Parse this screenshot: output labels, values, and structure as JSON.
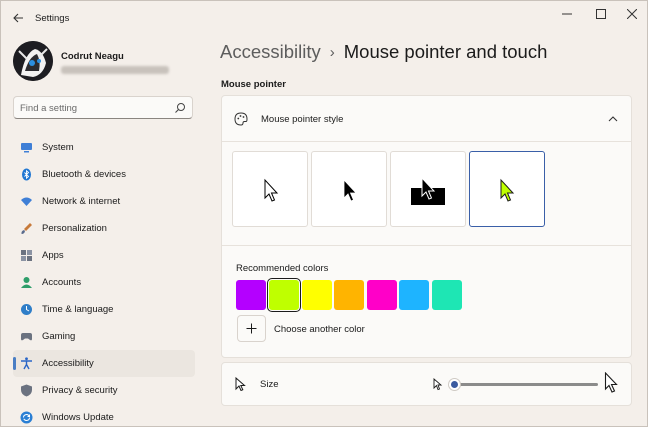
{
  "window": {
    "title": "Settings",
    "back_icon": "back-arrow-icon",
    "controls": [
      "minimize-icon",
      "maximize-icon",
      "close-icon"
    ]
  },
  "profile": {
    "name": "Codrut Neagu"
  },
  "search": {
    "placeholder": "Find a setting",
    "icon": "search-icon"
  },
  "sidebar": {
    "items": [
      {
        "label": "System",
        "icon": "system-icon",
        "color": "#3f7fd6",
        "active": false
      },
      {
        "label": "Bluetooth & devices",
        "icon": "bluetooth-icon",
        "color": "#1f76d2",
        "active": false
      },
      {
        "label": "Network & internet",
        "icon": "wifi-icon",
        "color": "#3f7fd6",
        "active": false
      },
      {
        "label": "Personalization",
        "icon": "brush-icon",
        "color": "#c77a3a",
        "active": false
      },
      {
        "label": "Apps",
        "icon": "apps-icon",
        "color": "#6b7280",
        "active": false
      },
      {
        "label": "Accounts",
        "icon": "accounts-icon",
        "color": "#2e9e6a",
        "active": false
      },
      {
        "label": "Time & language",
        "icon": "globe-clock-icon",
        "color": "#2f7ec8",
        "active": false
      },
      {
        "label": "Gaming",
        "icon": "gaming-icon",
        "color": "#6b7280",
        "active": false
      },
      {
        "label": "Accessibility",
        "icon": "accessibility-icon",
        "color": "#2a66c7",
        "active": true
      },
      {
        "label": "Privacy & security",
        "icon": "shield-icon",
        "color": "#6b7280",
        "active": false
      },
      {
        "label": "Windows Update",
        "icon": "update-icon",
        "color": "#2a7fd4",
        "active": false
      }
    ]
  },
  "breadcrumb": {
    "parent": "Accessibility",
    "separator": "›",
    "current": "Mouse pointer and touch"
  },
  "section": {
    "label": "Mouse pointer"
  },
  "pointer_card": {
    "title": "Mouse pointer style",
    "icon": "mouse-style-icon",
    "expanded": true,
    "styles": [
      {
        "name": "white",
        "selected": false
      },
      {
        "name": "black",
        "selected": false
      },
      {
        "name": "inverted",
        "selected": false
      },
      {
        "name": "custom",
        "selected": true,
        "color": "#bfff00"
      }
    ],
    "recommended_label": "Recommended colors",
    "colors": [
      {
        "hex": "#b400ff",
        "selected": false
      },
      {
        "hex": "#bfff00",
        "selected": true
      },
      {
        "hex": "#ffff00",
        "selected": false
      },
      {
        "hex": "#ffb400",
        "selected": false
      },
      {
        "hex": "#ff00c8",
        "selected": false
      },
      {
        "hex": "#1eb4ff",
        "selected": false
      },
      {
        "hex": "#1ee6b4",
        "selected": false
      }
    ],
    "add_color_label": "Choose another color",
    "add_icon": "plus-icon"
  },
  "size_card": {
    "label": "Size",
    "icon": "cursor-size-icon",
    "value_fraction": 0
  },
  "accent": "#3a5fa8"
}
